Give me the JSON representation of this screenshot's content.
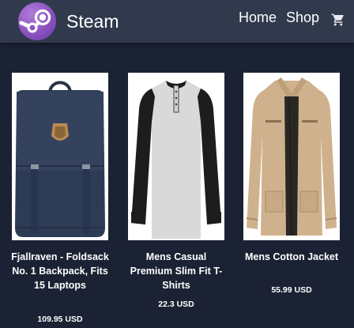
{
  "header": {
    "brand": "Steam",
    "logo_icon": "steam-logo-icon",
    "nav": [
      {
        "label": "Home"
      },
      {
        "label": "Shop"
      }
    ],
    "cart_icon": "shopping-cart-icon",
    "background": "#313a4d"
  },
  "page": {
    "background": "#1b2233"
  },
  "products": [
    {
      "title": "Fjallraven - Foldsack No. 1 Backpack, Fits 15 Laptops",
      "price": "109.95 USD",
      "image_icon": "backpack-image"
    },
    {
      "title": "Mens Casual Premium Slim Fit T-Shirts",
      "price": "22.3 USD",
      "image_icon": "raglan-shirt-image"
    },
    {
      "title": "Mens Cotton Jacket",
      "price": "55.99 USD",
      "image_icon": "cotton-jacket-image"
    }
  ]
}
